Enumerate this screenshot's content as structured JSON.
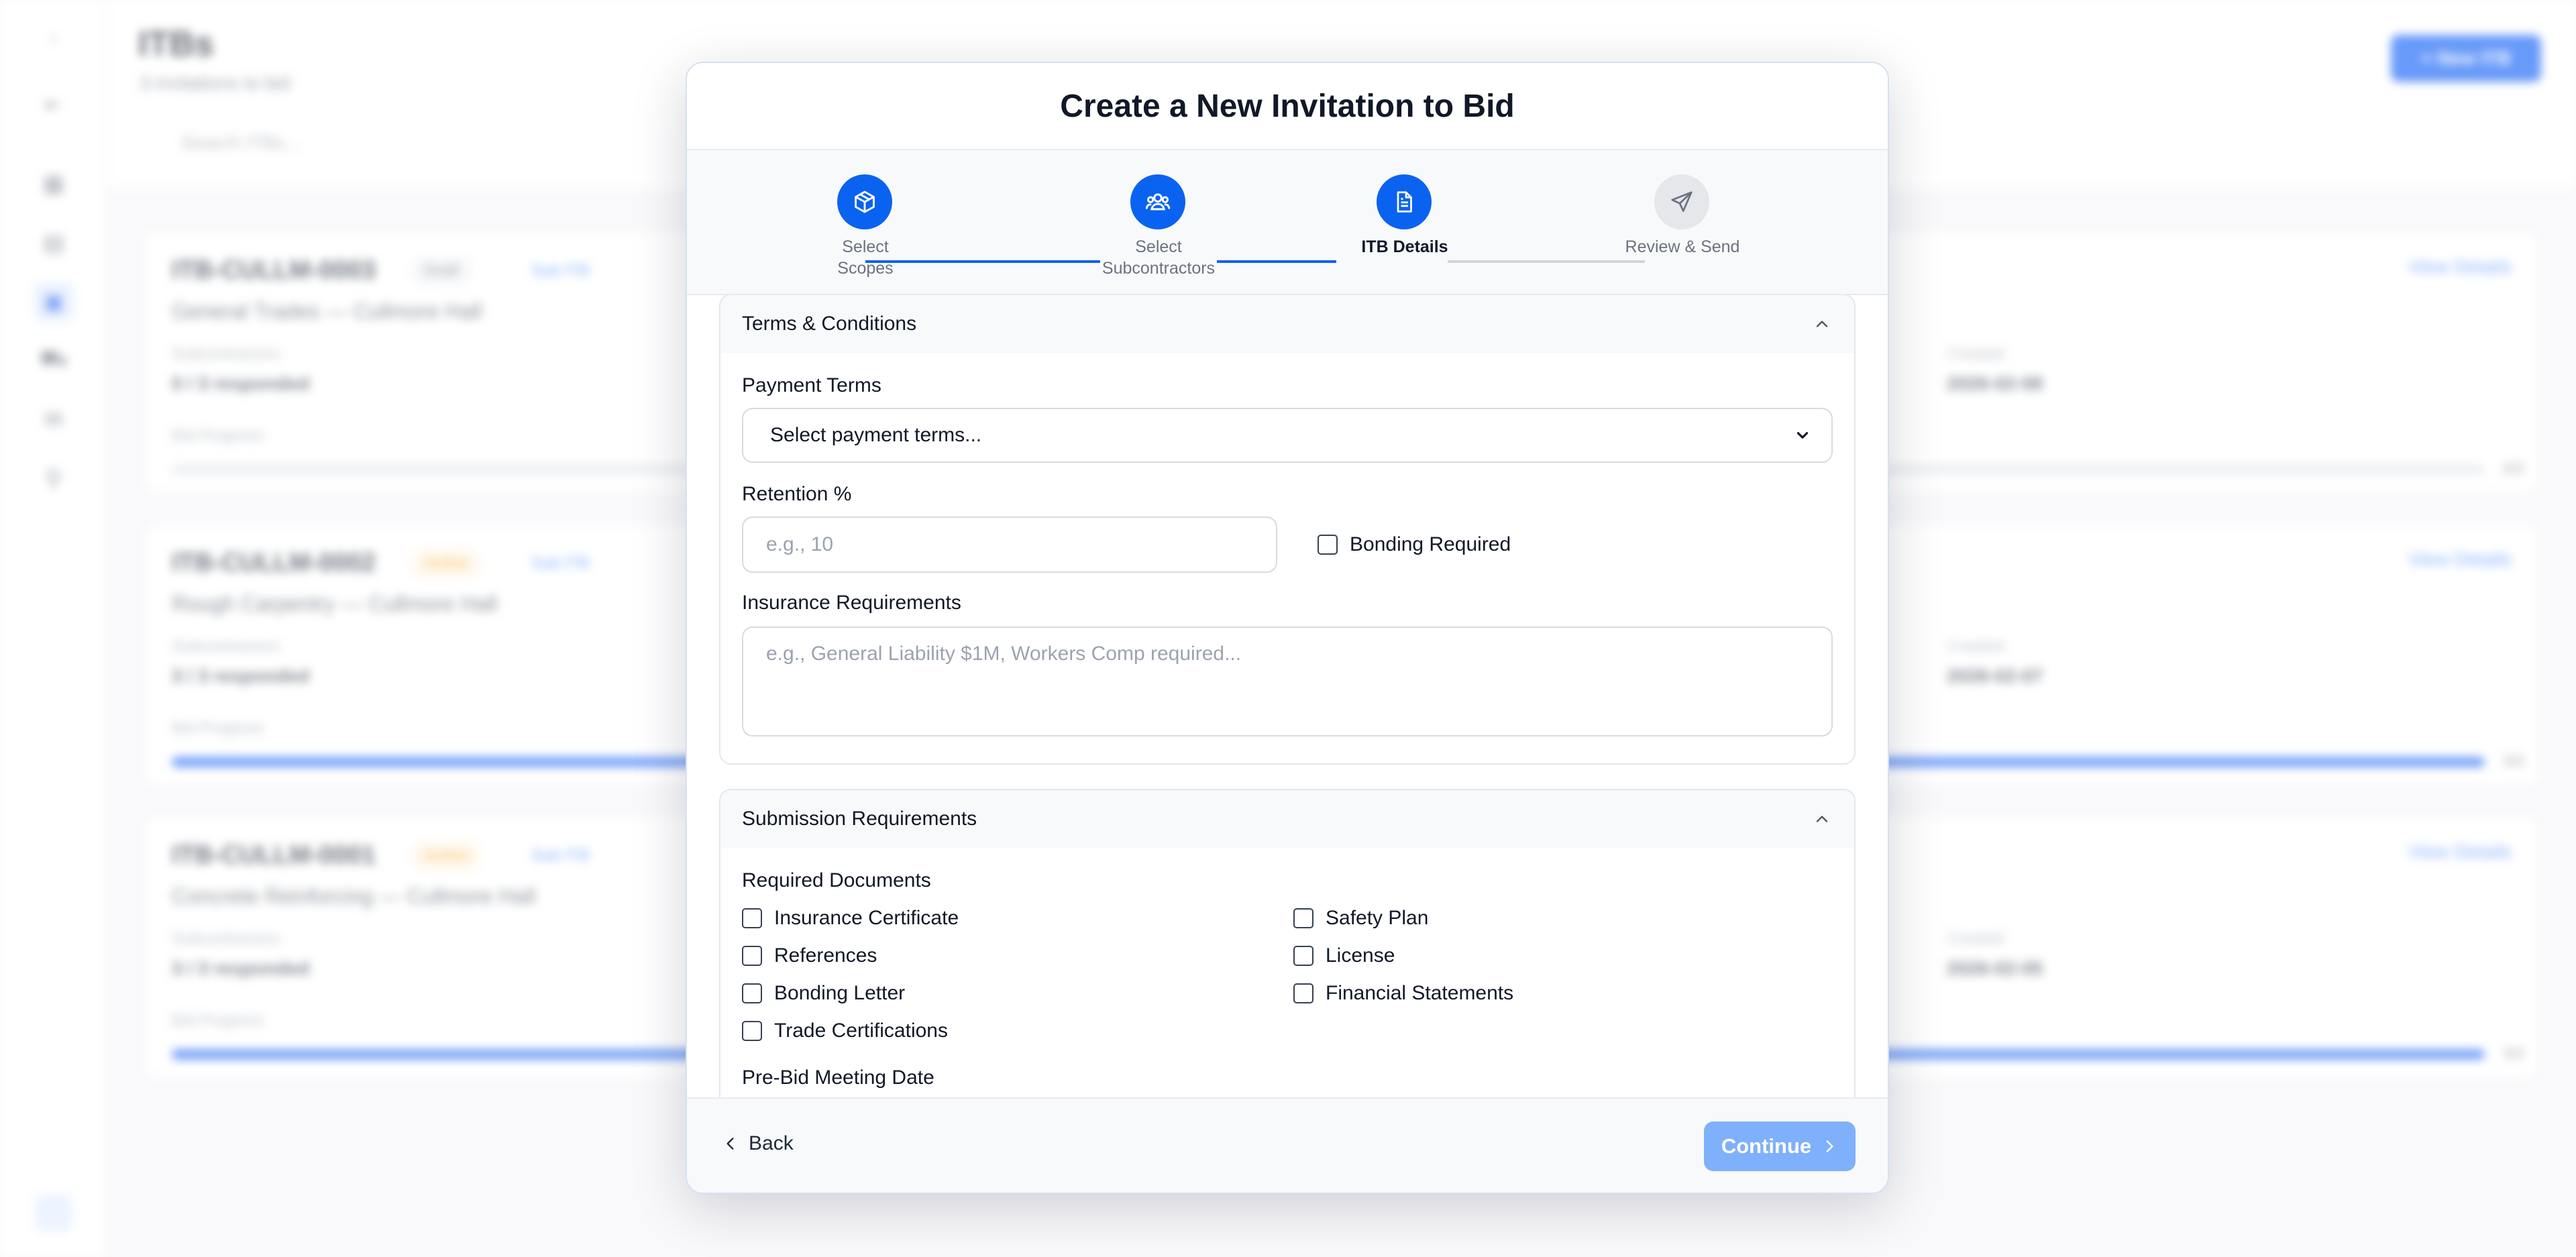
{
  "background": {
    "page_title": "ITBs",
    "page_subtitle": "3 invitations to bid",
    "search_placeholder": "Search ITBs...",
    "new_button": "+ New ITB",
    "cards": [
      {
        "id": "ITB-CULLM-0003",
        "status": "Draft",
        "tag": "Sub ITB",
        "name": "General Trades — Cullmore Hall",
        "subs_label": "Subcontractors",
        "subs_value": "0 / 3 responded",
        "created_label": "Created",
        "created_value": "2026-02-08",
        "progress_label": "Bid Progress",
        "progress": 0,
        "pct": "0/3",
        "view": "View Details"
      },
      {
        "id": "ITB-CULLM-0002",
        "status": "Active",
        "tag": "Sub ITB",
        "name": "Rough Carpentry — Cullmore Hall",
        "subs_label": "Subcontractors",
        "subs_value": "3 / 3 responded",
        "created_label": "Created",
        "created_value": "2026-02-07",
        "progress_label": "Bid Progress",
        "progress": 1,
        "pct": "3/3",
        "view": "View Details"
      },
      {
        "id": "ITB-CULLM-0001",
        "status": "Active",
        "tag": "Sub ITB",
        "name": "Concrete Reinforcing — Cullmore Hall",
        "subs_label": "Subcontractors",
        "subs_value": "3 / 3 responded",
        "created_label": "Created",
        "created_value": "2026-02-05",
        "progress_label": "Bid Progress",
        "progress": 1,
        "pct": "3/3",
        "view": "View Details"
      }
    ]
  },
  "modal": {
    "title": "Create a New Invitation to Bid",
    "steps": [
      {
        "label": "Select\nScopes",
        "state": "complete",
        "icon": "cube-icon"
      },
      {
        "label": "Select\nSubcontractors",
        "state": "complete",
        "icon": "users-icon"
      },
      {
        "label": "ITB Details",
        "state": "active",
        "icon": "document-icon"
      },
      {
        "label": "Review & Send",
        "state": "pending",
        "icon": "send-icon"
      }
    ],
    "terms": {
      "title": "Terms & Conditions",
      "payment_label": "Payment Terms",
      "payment_value": "Select payment terms...",
      "retention_label": "Retention %",
      "retention_placeholder": "e.g., 10",
      "bonding_label": "Bonding Required",
      "insurance_label": "Insurance Requirements",
      "insurance_placeholder": "e.g., General Liability $1M, Workers Comp required..."
    },
    "submission": {
      "title": "Submission Requirements",
      "docs_label": "Required Documents",
      "documents": [
        "Insurance Certificate",
        "Safety Plan",
        "References",
        "License",
        "Bonding Letter",
        "Financial Statements",
        "Trade Certifications"
      ],
      "prebid_label": "Pre-Bid Meeting Date"
    },
    "footer": {
      "back_label": "Back",
      "continue_label": "Continue"
    }
  },
  "colors": {
    "primary": "#0a63f0",
    "continue_disabled": "#7fb0fb",
    "step_pending": "#e5e7eb"
  }
}
